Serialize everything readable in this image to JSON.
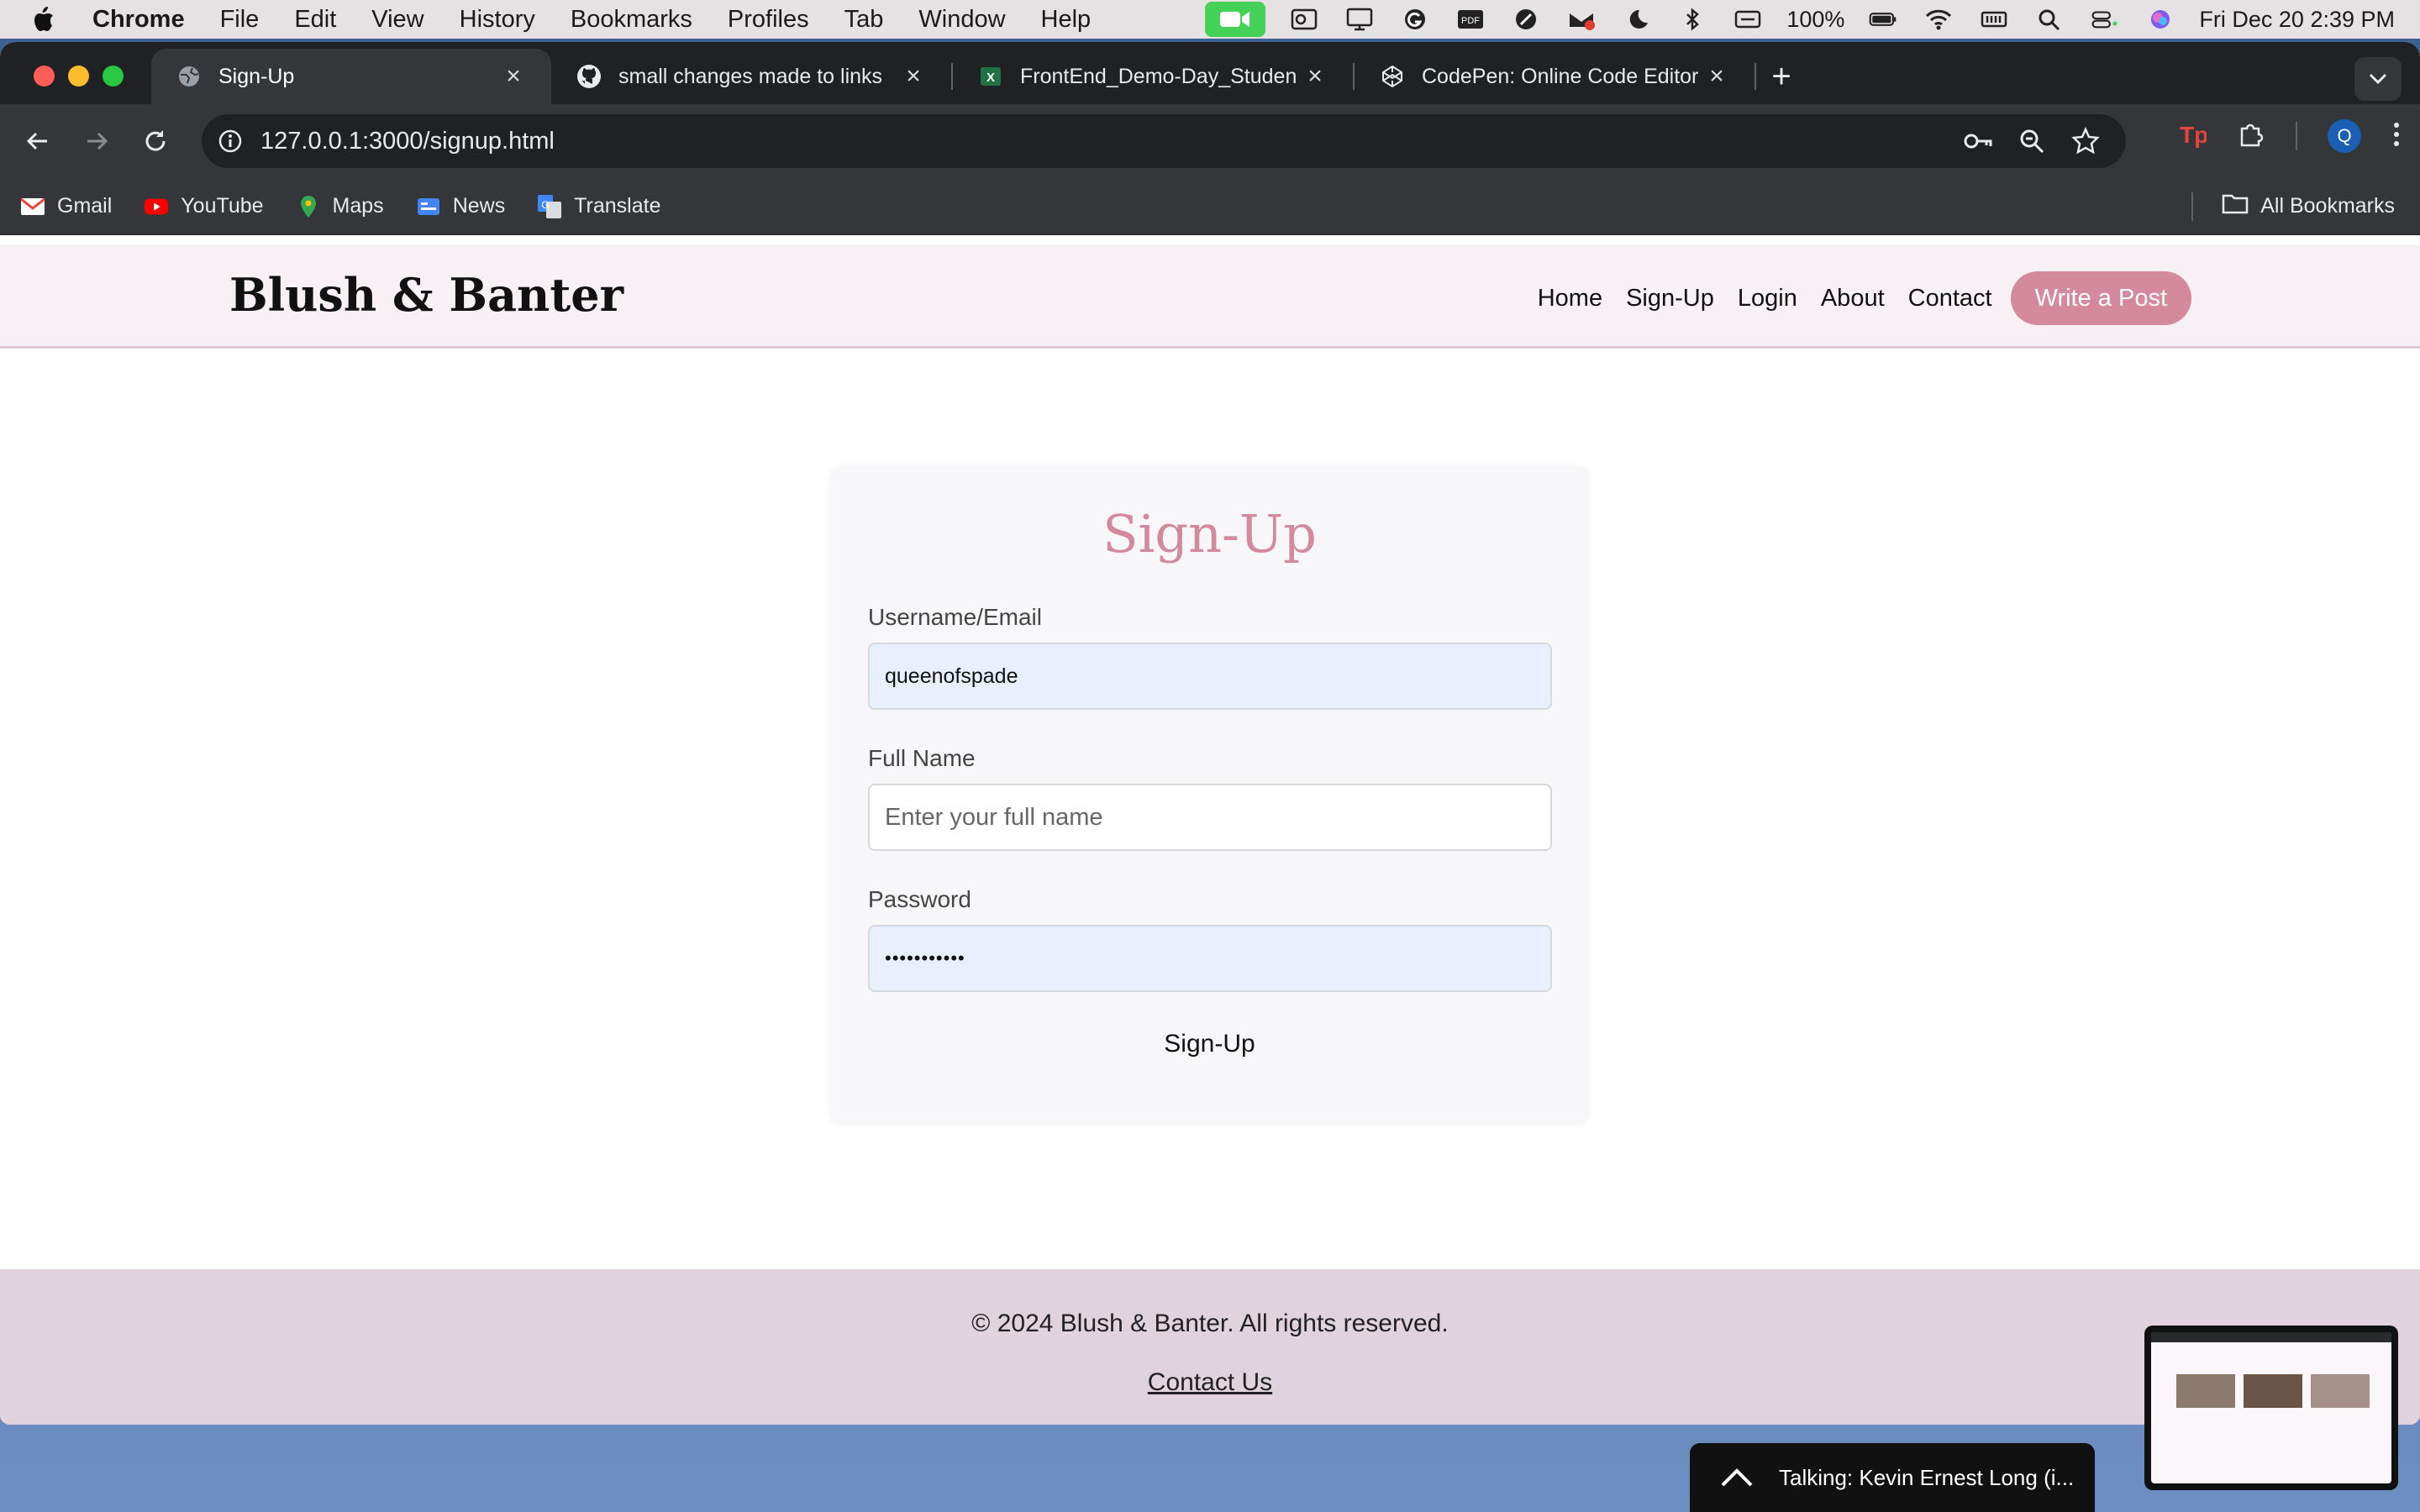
{
  "menubar": {
    "app": "Chrome",
    "items": [
      "File",
      "Edit",
      "View",
      "History",
      "Bookmarks",
      "Profiles",
      "Tab",
      "Window",
      "Help"
    ],
    "battery": "100%",
    "datetime": "Fri Dec 20  2:39 PM"
  },
  "tabs": [
    {
      "title": "Sign-Up",
      "icon": "globe-icon",
      "active": true
    },
    {
      "title": "small changes made to links",
      "icon": "github-icon",
      "active": false
    },
    {
      "title": "FrontEnd_Demo-Day_Studen",
      "icon": "excel-icon",
      "active": false
    },
    {
      "title": "CodePen: Online Code Editor",
      "icon": "codepen-icon",
      "active": false
    }
  ],
  "omnibox": {
    "url": "127.0.0.1:3000/signup.html"
  },
  "bookmarks": [
    {
      "label": "Gmail",
      "icon": "gmail-icon"
    },
    {
      "label": "YouTube",
      "icon": "youtube-icon"
    },
    {
      "label": "Maps",
      "icon": "maps-icon"
    },
    {
      "label": "News",
      "icon": "news-icon"
    },
    {
      "label": "Translate",
      "icon": "translate-icon"
    }
  ],
  "bookmarks_all": "All Bookmarks",
  "profile_initial": "Q",
  "site": {
    "logo": "Blush & Banter",
    "nav": [
      "Home",
      "Sign-Up",
      "Login",
      "About",
      "Contact"
    ],
    "cta": "Write a Post",
    "accent": "#d48a9c"
  },
  "form": {
    "heading": "Sign-Up",
    "username_label": "Username/Email",
    "username_value": "queenofspade",
    "fullname_label": "Full Name",
    "fullname_placeholder": "Enter your full name",
    "password_label": "Password",
    "password_value": "•••••••••••",
    "submit": "Sign-Up"
  },
  "footer": {
    "copyright": "© 2024 Blush & Banter. All rights reserved.",
    "link": "Contact Us"
  },
  "call": {
    "status": "Talking: Kevin Ernest Long (i..."
  }
}
